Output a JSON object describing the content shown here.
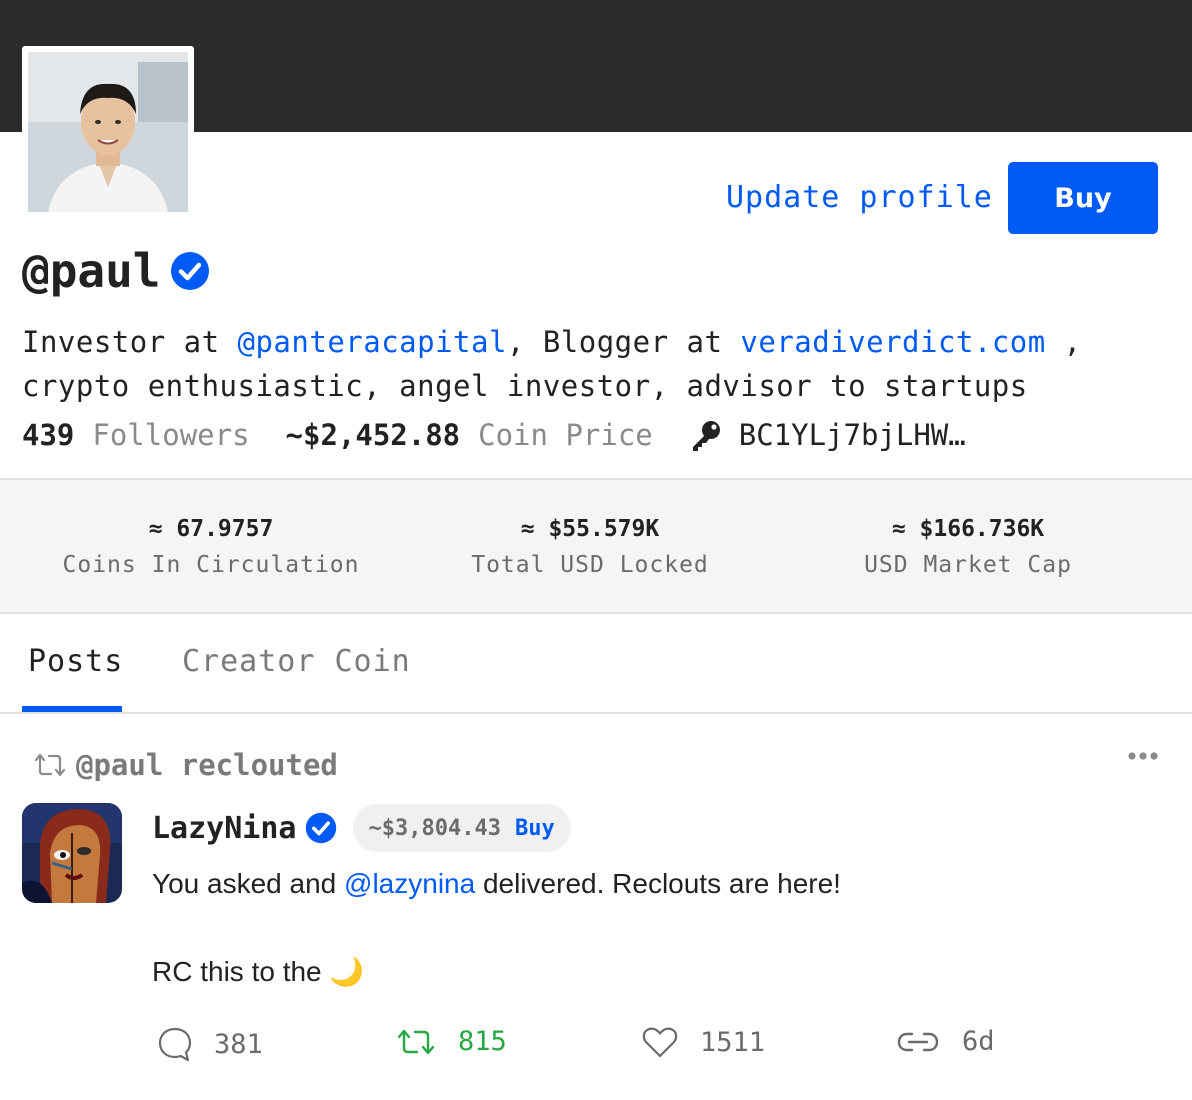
{
  "header": {
    "update_profile_label": "Update profile",
    "buy_label": "Buy"
  },
  "profile": {
    "username": "@paul",
    "verified": true,
    "bio": {
      "part1": "Investor at ",
      "mention": "@panteracapital",
      "part2": ", Blogger at ",
      "site": "veradiverdict.com",
      "part3": " ,",
      "line2": "crypto enthusiastic, angel investor, advisor to startups"
    },
    "followers_count": "439",
    "followers_label": "Followers",
    "coin_price": "~$2,452.88",
    "coin_price_label": "Coin Price",
    "public_key": "BC1YLj7bjLHW…"
  },
  "metrics": [
    {
      "value": "≈ 67.9757",
      "label": "Coins In Circulation"
    },
    {
      "value": "≈ $55.579K",
      "label": "Total USD Locked"
    },
    {
      "value": "≈ $166.736K",
      "label": "USD Market Cap"
    }
  ],
  "tabs": [
    {
      "label": "Posts",
      "active": true
    },
    {
      "label": "Creator Coin",
      "active": false
    }
  ],
  "post": {
    "reclout_by": "@paul reclouted",
    "author": "LazyNina",
    "author_verified": true,
    "author_price": "~$3,804.43",
    "author_buy_label": "Buy",
    "body_prefix": "You asked and ",
    "body_mention": "@lazynina",
    "body_suffix": " delivered. Reclouts are here!",
    "body_line2": "RC this to the ",
    "body_emoji": "🌙",
    "comments": "381",
    "reclouts": "815",
    "likes": "1511",
    "age": "6d"
  },
  "colors": {
    "accent": "#005bf6",
    "banner": "#2b2b2b",
    "reclout_green": "#27a844",
    "muted": "#8a8a8a"
  },
  "icons": [
    "verified-icon",
    "key-icon",
    "reclout-icon",
    "more-icon",
    "comment-icon",
    "heart-icon",
    "link-icon"
  ]
}
